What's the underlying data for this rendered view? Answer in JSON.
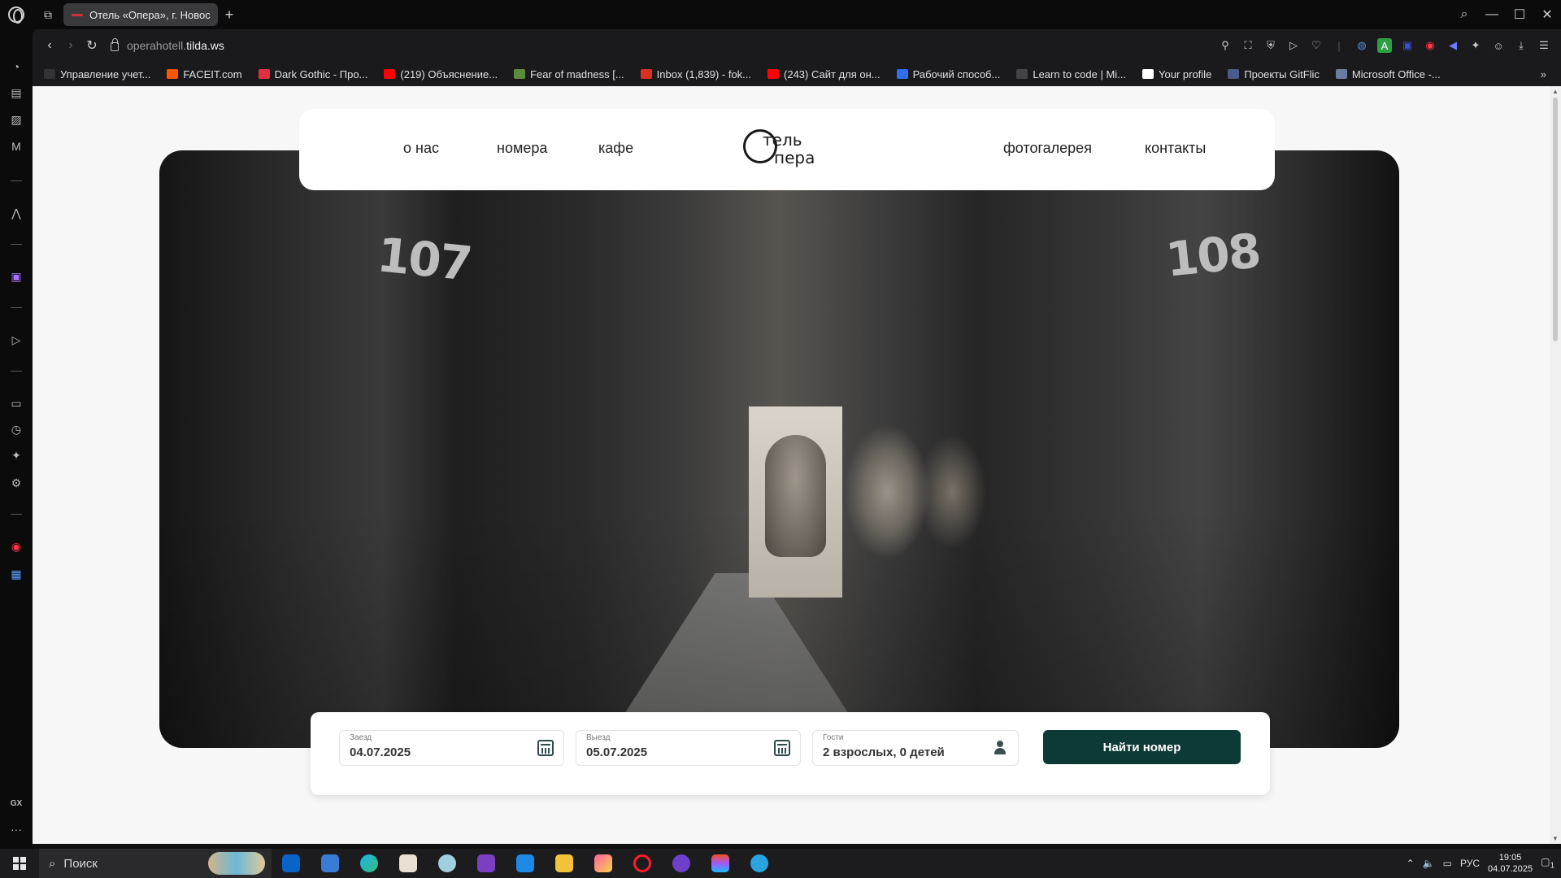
{
  "browser": {
    "tab_title": "Отель «Опера», г. Новос",
    "url_prefix": "operahotell.",
    "url_domain": "tilda.ws",
    "bookmarks": [
      {
        "label": "Управление учет...",
        "color": "#333333"
      },
      {
        "label": "FACEIT.com",
        "color": "#ff5500"
      },
      {
        "label": "Dark Gothic - Про...",
        "color": "#e03040"
      },
      {
        "label": "(219) Объяснение...",
        "color": "#ff0000"
      },
      {
        "label": "Fear of madness [...",
        "color": "#5b8a3c"
      },
      {
        "label": "Inbox (1,839) - fok...",
        "color": "#d93025"
      },
      {
        "label": "(243) Сайт для он...",
        "color": "#ff0000"
      },
      {
        "label": "Рабочий способ...",
        "color": "#2f6fed"
      },
      {
        "label": "Learn to code | Mi...",
        "color": "#444444"
      },
      {
        "label": "Your profile",
        "color": "#ffffff"
      },
      {
        "label": "Проекты GitFlic",
        "color": "#4a5a8a"
      },
      {
        "label": "Microsoft Office -...",
        "color": "#6a7aa0"
      }
    ]
  },
  "site": {
    "nav": {
      "about": "о нас",
      "rooms": "номера",
      "cafe": "кафе",
      "gallery": "фотогалерея",
      "contacts": "контакты"
    },
    "logo": {
      "line1": "тель",
      "line2": "пера"
    },
    "hero": {
      "door_left": "107",
      "door_right": "108"
    },
    "booking": {
      "checkin_label": "Заезд",
      "checkin_value": "04.07.2025",
      "checkout_label": "Выезд",
      "checkout_value": "05.07.2025",
      "guests_label": "Гости",
      "guests_value": "2 взрослых, 0 детей",
      "search_button": "Найти номер"
    }
  },
  "taskbar": {
    "search_placeholder": "Поиск",
    "language": "РУС",
    "time": "19:05",
    "date": "04.07.2025",
    "notifications": "1"
  }
}
